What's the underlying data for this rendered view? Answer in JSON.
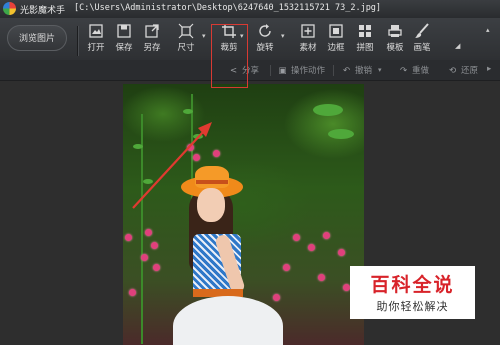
{
  "window": {
    "app_title": "光影魔术手",
    "file_path": "[C:\\Users\\Administrator\\Desktop\\6247640_1532115721 73_2.jpg]"
  },
  "toolbar": {
    "browse_label": "浏览图片",
    "tools": [
      {
        "label": "打开",
        "icon": "open-icon"
      },
      {
        "label": "保存",
        "icon": "save-icon"
      },
      {
        "label": "另存",
        "icon": "save-as-icon"
      },
      {
        "label": "尺寸",
        "icon": "resize-icon"
      },
      {
        "label": "裁剪",
        "icon": "crop-icon"
      },
      {
        "label": "旋转",
        "icon": "rotate-icon"
      },
      {
        "label": "素材",
        "icon": "material-icon"
      },
      {
        "label": "边框",
        "icon": "border-icon"
      },
      {
        "label": "拼图",
        "icon": "collage-icon"
      },
      {
        "label": "模板",
        "icon": "template-icon"
      },
      {
        "label": "画笔",
        "icon": "brush-icon"
      }
    ]
  },
  "subbar": {
    "share": "分享",
    "batch": "操作动作",
    "undo": "撤销",
    "redo": "重做",
    "restore": "还原"
  },
  "watermark": {
    "title": "百科全说",
    "subtitle": "助你轻松解决"
  },
  "colors": {
    "highlight": "#d83a33",
    "watermark_red": "#d8232a"
  }
}
